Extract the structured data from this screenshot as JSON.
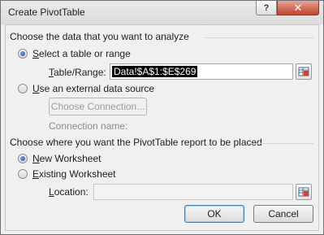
{
  "window": {
    "title": "Create PivotTable",
    "help_label": "?",
    "close_label": "✕"
  },
  "analyze_section": {
    "heading": "Choose the data that you want to analyze",
    "select_table_option": {
      "prefix": "",
      "underlined": "S",
      "rest": "elect a table or range",
      "selected": true
    },
    "table_range_label": {
      "underlined": "T",
      "rest": "able/Range:"
    },
    "table_range_value": "Data!$A$1:$E$269",
    "external_source_option": {
      "underlined": "U",
      "rest": "se an external data source",
      "selected": false
    },
    "choose_connection_label": "Choose Connection...",
    "connection_name_label": "Connection name:"
  },
  "placement_section": {
    "heading": "Choose where you want the PivotTable report to be placed",
    "new_worksheet_option": {
      "underlined": "N",
      "rest": "ew Worksheet",
      "selected": true
    },
    "existing_worksheet_option": {
      "underlined": "E",
      "rest": "xisting Worksheet",
      "selected": false
    },
    "location_label": {
      "underlined": "L",
      "rest": "ocation:"
    },
    "location_value": ""
  },
  "buttons": {
    "ok_label": "OK",
    "cancel_label": "Cancel"
  },
  "icons": {
    "range_picker": "range-picker-icon"
  }
}
